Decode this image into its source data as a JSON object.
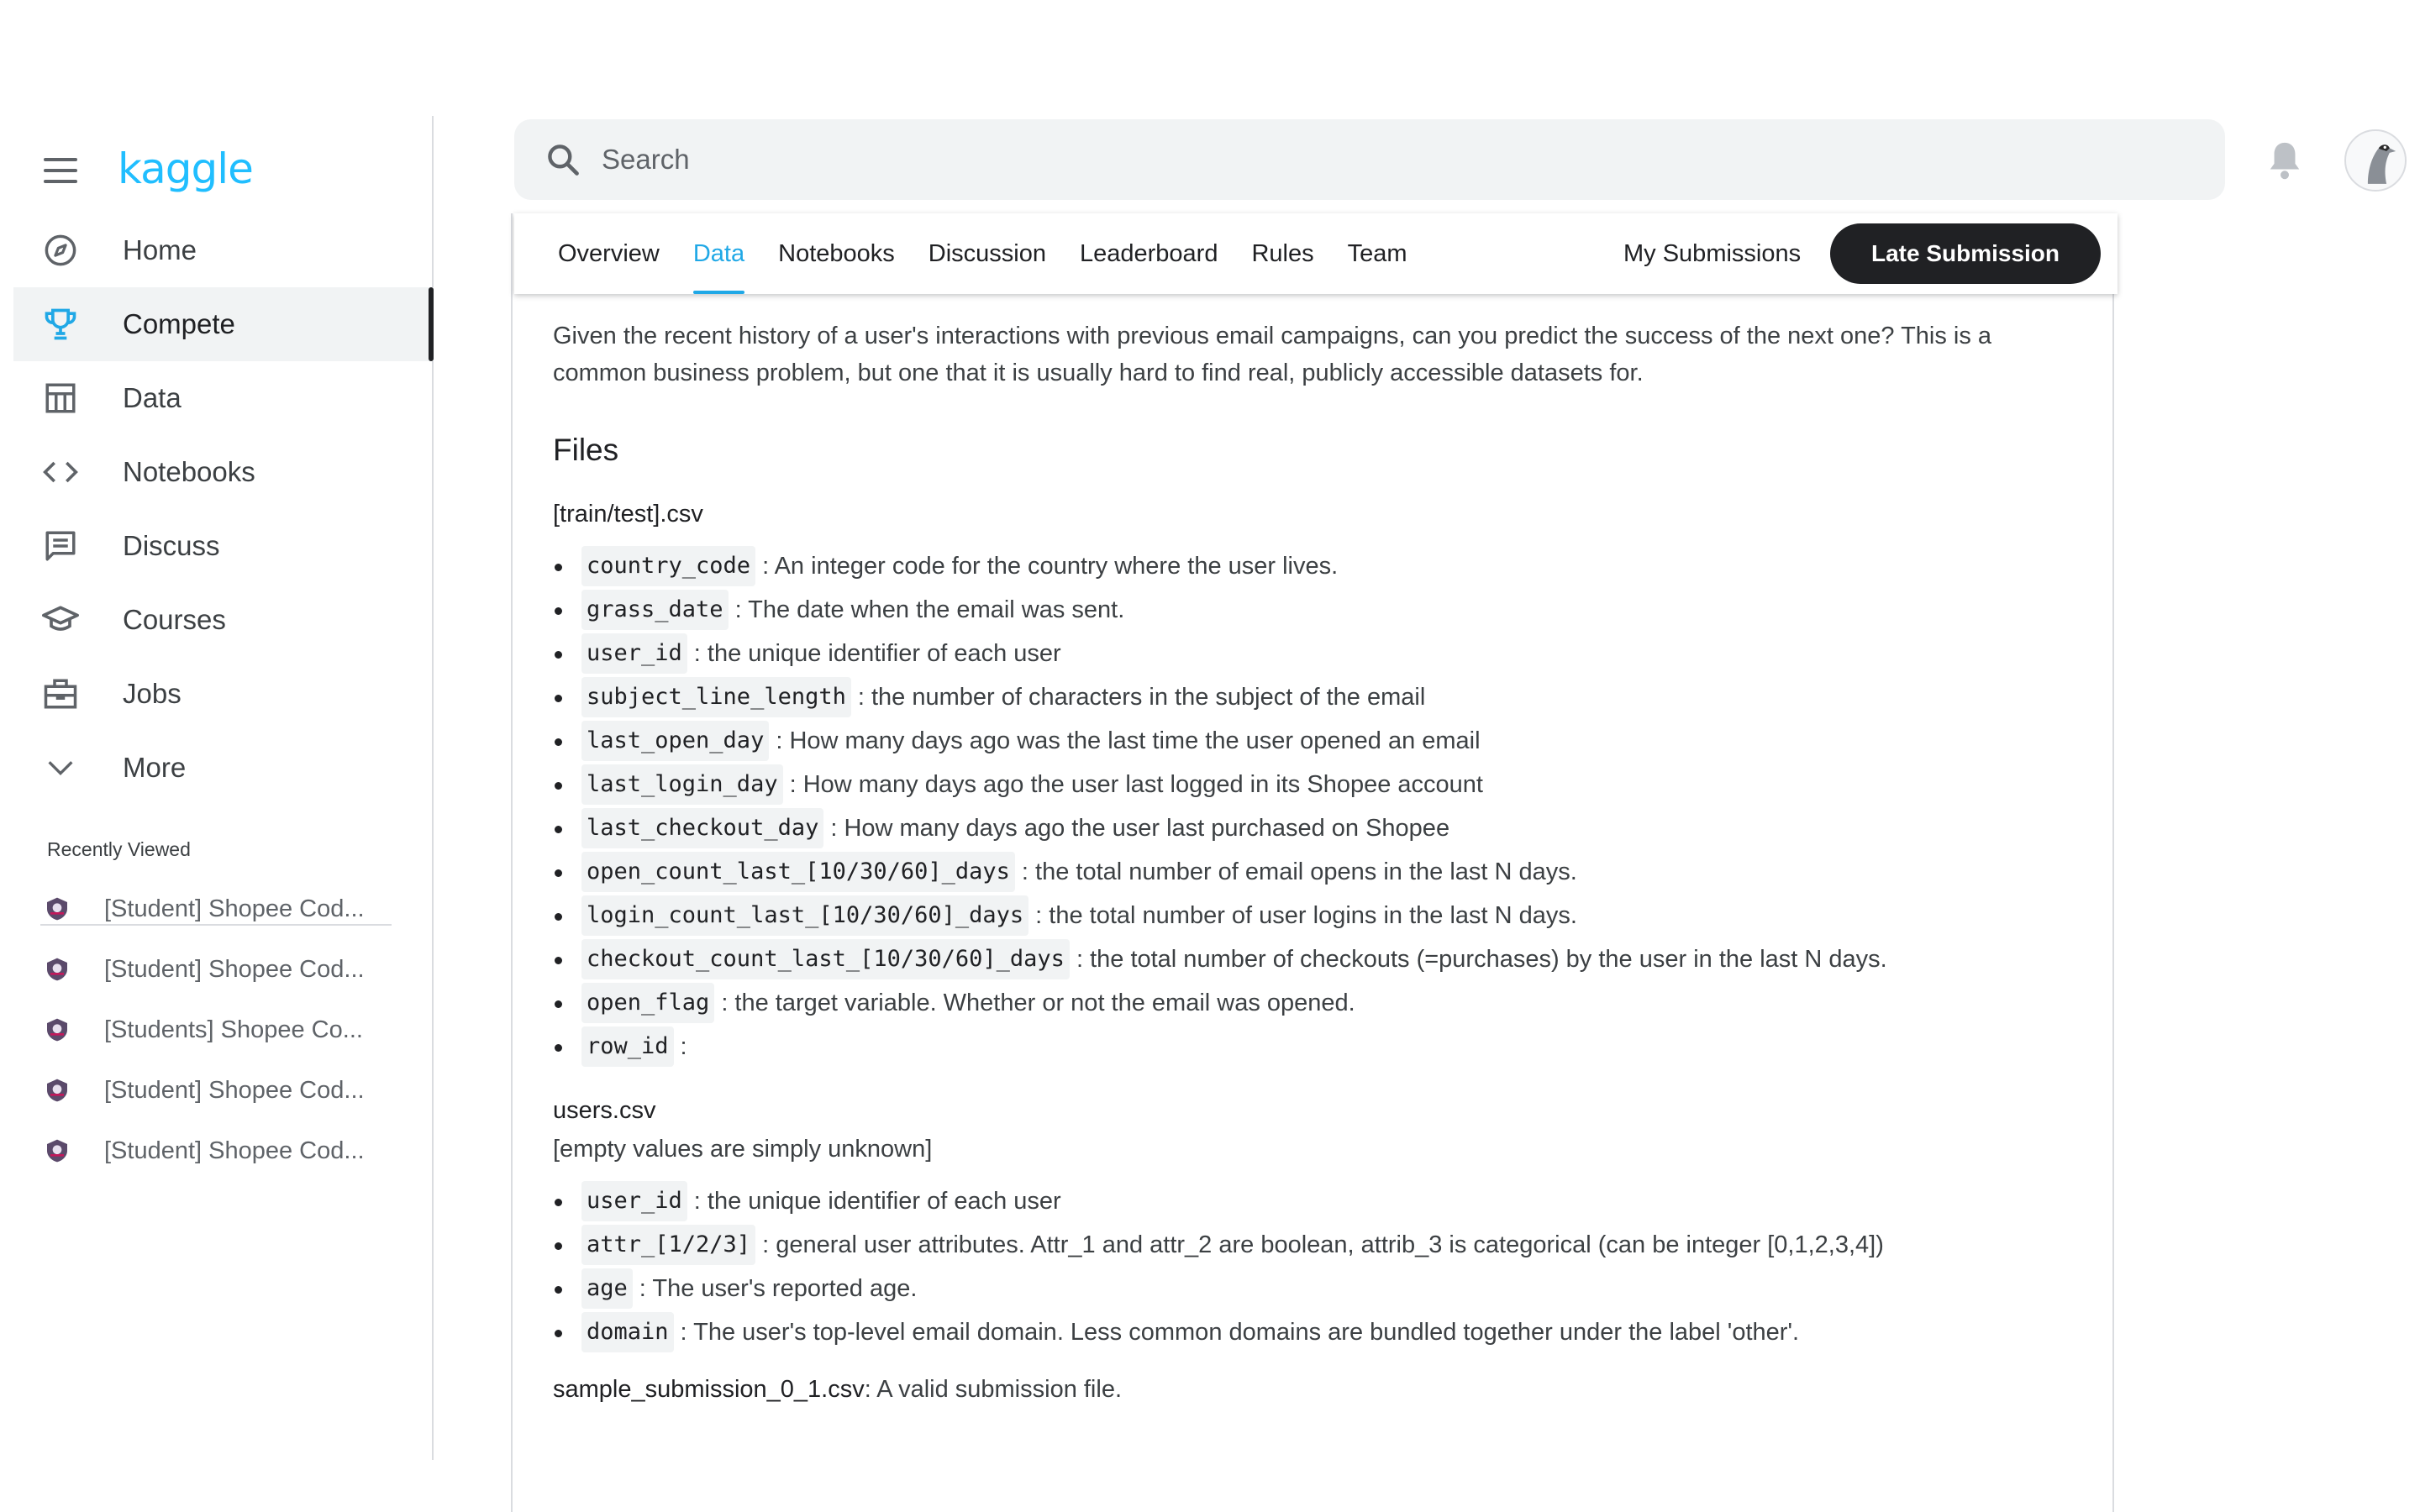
{
  "sidebar": {
    "logo": "kaggle",
    "nav": [
      {
        "label": "Home",
        "icon": "compass-icon"
      },
      {
        "label": "Compete",
        "icon": "trophy-icon",
        "active": true
      },
      {
        "label": "Data",
        "icon": "table-icon"
      },
      {
        "label": "Notebooks",
        "icon": "code-icon"
      },
      {
        "label": "Discuss",
        "icon": "comment-icon"
      },
      {
        "label": "Courses",
        "icon": "graduation-cap-icon"
      },
      {
        "label": "Jobs",
        "icon": "briefcase-icon"
      },
      {
        "label": "More",
        "icon": "chevron-down-icon"
      }
    ],
    "recent_title": "Recently Viewed",
    "recent": [
      "[Student] Shopee Cod...",
      "[Student] Shopee Cod...",
      "[Students] Shopee Co...",
      "[Student] Shopee Cod...",
      "[Student] Shopee Cod..."
    ]
  },
  "search": {
    "placeholder": "Search"
  },
  "tabs": [
    "Overview",
    "Data",
    "Notebooks",
    "Discussion",
    "Leaderboard",
    "Rules",
    "Team"
  ],
  "active_tab": "Data",
  "my_submissions": "My Submissions",
  "late_submission": "Late Submission",
  "content": {
    "intro": "Given the recent history of a user's interactions with previous email campaigns, can you predict the success of the next one? This is a common business problem, but one that it is usually hard to find real, publicly accessible datasets for.",
    "files_heading": "Files",
    "train_test_title": "[train/test].csv",
    "train_fields": [
      {
        "code": "country_code",
        "desc": ": An integer code for the country where the user lives."
      },
      {
        "code": "grass_date",
        "desc": ": The date when the email was sent."
      },
      {
        "code": "user_id",
        "desc": ": the unique identifier of each user"
      },
      {
        "code": "subject_line_length",
        "desc": ": the number of characters in the subject of the email"
      },
      {
        "code": "last_open_day",
        "desc": ": How many days ago was the last time the user opened an email"
      },
      {
        "code": "last_login_day",
        "desc": ": How many days ago the user last logged in its Shopee account"
      },
      {
        "code": "last_checkout_day",
        "desc": ": How many days ago the user last purchased on Shopee"
      },
      {
        "code": "open_count_last_[10/30/60]_days",
        "desc": ": the total number of email opens in the last N days."
      },
      {
        "code": "login_count_last_[10/30/60]_days",
        "desc": ": the total number of user logins in the last N days."
      },
      {
        "code": "checkout_count_last_[10/30/60]_days",
        "desc": ": the total number of checkouts (=purchases) by the user in the last N days."
      },
      {
        "code": "open_flag",
        "desc": ": the target variable. Whether or not the email was opened."
      },
      {
        "code": "row_id",
        "desc": ":"
      }
    ],
    "users_title": "users.csv",
    "users_note": "[empty values are simply unknown]",
    "users_fields": [
      {
        "code": "user_id",
        "desc": ": the unique identifier of each user"
      },
      {
        "code": "attr_[1/2/3]",
        "desc": ": general user attributes. Attr_1 and attr_2 are boolean, attrib_3 is categorical (can be integer [0,1,2,3,4])"
      },
      {
        "code": "age",
        "desc": ": The user's reported age."
      },
      {
        "code": "domain",
        "desc": ": The user's top-level email domain. Less common domains are bundled together under the label 'other'."
      }
    ],
    "sample_file": "sample_submission_0_1.csv",
    "sample_desc": ": A valid submission file."
  },
  "colors": {
    "accent": "#20beff",
    "tab_active": "#20a8e6",
    "button_dark": "#202124"
  }
}
